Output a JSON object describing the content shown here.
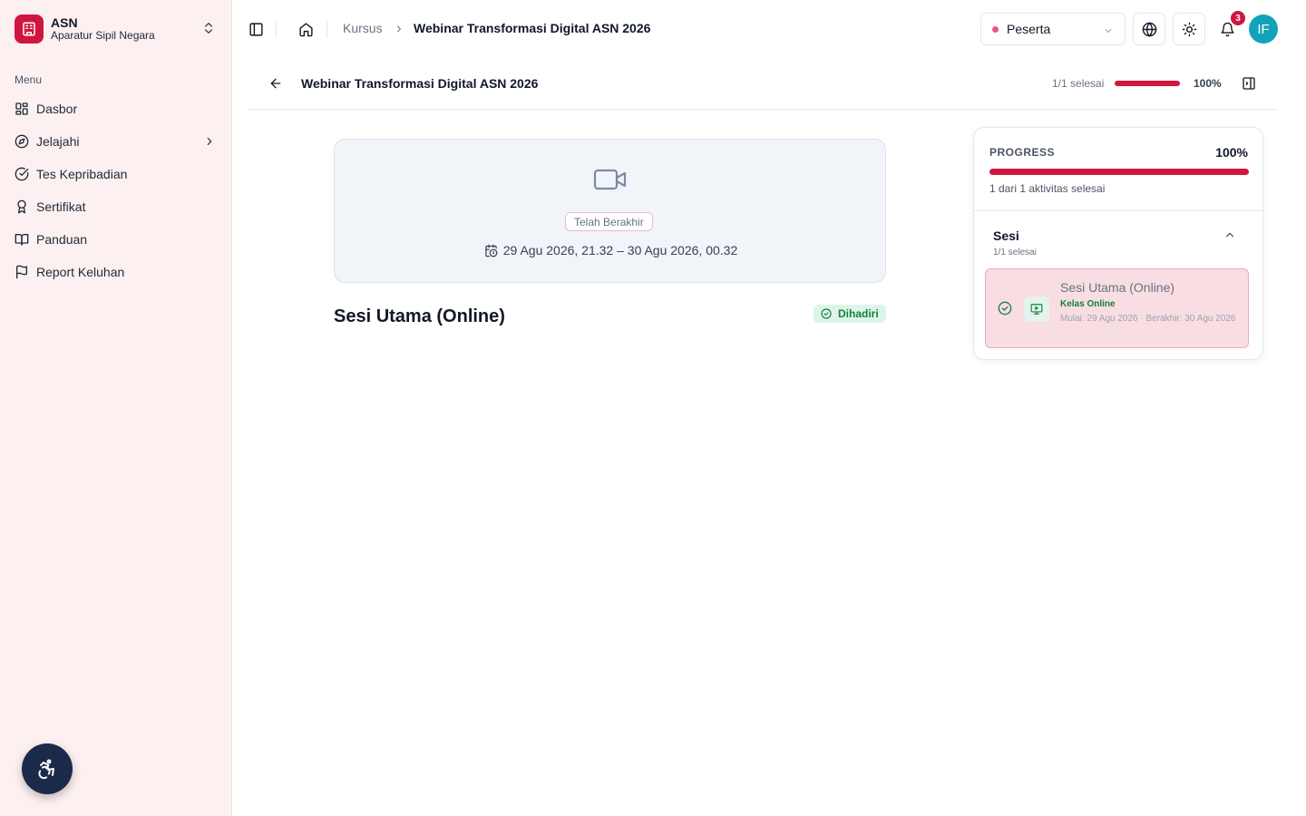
{
  "brand": {
    "name": "ASN",
    "subtitle": "Aparatur Sipil Negara"
  },
  "sidebar": {
    "menu_label": "Menu",
    "items": [
      {
        "label": "Dasbor",
        "icon": "grid-icon"
      },
      {
        "label": "Jelajahi",
        "icon": "compass-icon",
        "has_children": true
      },
      {
        "label": "Tes Kepribadian",
        "icon": "check-circle-icon"
      },
      {
        "label": "Sertifikat",
        "icon": "award-icon"
      },
      {
        "label": "Panduan",
        "icon": "book-open-icon"
      },
      {
        "label": "Report Keluhan",
        "icon": "flag-icon"
      }
    ]
  },
  "breadcrumb": {
    "parent": "Kursus",
    "current": "Webinar Transformasi Digital ASN 2026"
  },
  "topbar": {
    "role": "Peserta",
    "notification_count": "3",
    "avatar_initials": "IF"
  },
  "course": {
    "title": "Webinar Transformasi Digital ASN 2026",
    "done_text": "1/1 selesai",
    "progress_percent": 100,
    "progress_label": "100%"
  },
  "session": {
    "status": "Telah Berakhir",
    "schedule": "29 Agu 2026, 21.32 – 30 Agu 2026, 00.32",
    "title": "Sesi Utama (Online)",
    "attendance": "Dihadiri"
  },
  "progress_panel": {
    "label": "PROGRESS",
    "percent": 100,
    "percent_label": "100%",
    "summary": "1 dari 1 aktivitas selesai",
    "section_title": "Sesi",
    "section_sub": "1/1 selesai",
    "items": [
      {
        "title": "Sesi Utama (Online)",
        "type": "Kelas Online",
        "dates": "Mulai: 29 Agu 2026 · Berakhir: 30 Agu 2026"
      }
    ]
  },
  "colors": {
    "brand": "#d0163e",
    "sidebar_bg": "#fdf0f1",
    "success": "#15803d",
    "avatar": "#12a3b8"
  }
}
